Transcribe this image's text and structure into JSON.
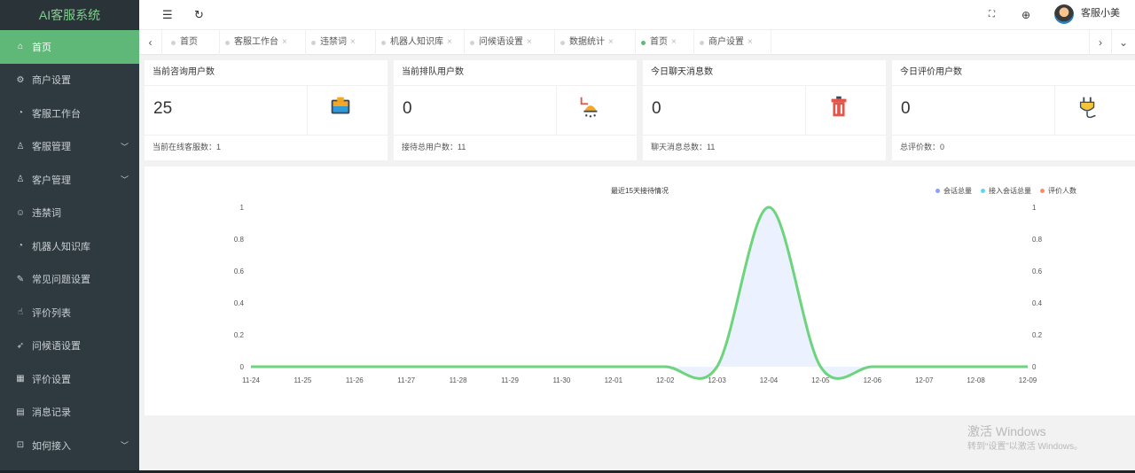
{
  "app": {
    "title": "AI客服系统"
  },
  "sidebar": {
    "items": [
      {
        "label": "首页",
        "icon": "home-icon",
        "glyph": "⌂",
        "active": true,
        "arrow": false
      },
      {
        "label": "商户设置",
        "icon": "gear-icon",
        "glyph": "⚙",
        "active": false,
        "arrow": false
      },
      {
        "label": "客服工作台",
        "icon": "headset-icon",
        "glyph": "◔",
        "active": false,
        "arrow": false
      },
      {
        "label": "客服管理",
        "icon": "user-icon",
        "glyph": "♙",
        "active": false,
        "arrow": true
      },
      {
        "label": "客户管理",
        "icon": "users-icon",
        "glyph": "♙",
        "active": false,
        "arrow": true
      },
      {
        "label": "违禁词",
        "icon": "smile-icon",
        "glyph": "☺",
        "active": false,
        "arrow": false
      },
      {
        "label": "机器人知识库",
        "icon": "robot-icon",
        "glyph": "◔",
        "active": false,
        "arrow": false
      },
      {
        "label": "常见问题设置",
        "icon": "edit-icon",
        "glyph": "✎",
        "active": false,
        "arrow": false
      },
      {
        "label": "评价列表",
        "icon": "thumb-icon",
        "glyph": "☝",
        "active": false,
        "arrow": false
      },
      {
        "label": "问候语设置",
        "icon": "send-icon",
        "glyph": "➶",
        "active": false,
        "arrow": false
      },
      {
        "label": "评价设置",
        "icon": "calendar-icon",
        "glyph": "▦",
        "active": false,
        "arrow": false
      },
      {
        "label": "消息记录",
        "icon": "message-icon",
        "glyph": "▤",
        "active": false,
        "arrow": false
      },
      {
        "label": "如何接入",
        "icon": "plug-icon",
        "glyph": "⊡",
        "active": false,
        "arrow": true
      }
    ],
    "arrow_glyph": "﹀"
  },
  "header": {
    "menu_glyph": "☰",
    "refresh_glyph": "↻",
    "fullscreen_glyph": "⛶",
    "language_glyph": "⊕",
    "username": "客服小美"
  },
  "tabs": {
    "prev_glyph": "‹",
    "next_glyph": "›",
    "more_glyph": "⌄",
    "close_glyph": "×",
    "items": [
      {
        "label": "首页",
        "closable": false,
        "active": false
      },
      {
        "label": "客服工作台",
        "closable": true,
        "active": false
      },
      {
        "label": "违禁词",
        "closable": true,
        "active": false
      },
      {
        "label": "机器人知识库",
        "closable": true,
        "active": false
      },
      {
        "label": "问候语设置",
        "closable": true,
        "active": false
      },
      {
        "label": "数据统计",
        "closable": true,
        "active": false
      },
      {
        "label": "首页",
        "closable": true,
        "active": true
      },
      {
        "label": "商户设置",
        "closable": true,
        "active": false
      }
    ]
  },
  "cards": [
    {
      "title": "当前咨询用户数",
      "value": "25",
      "footer": "当前在线客服数：1",
      "icon": "paint-bucket-icon"
    },
    {
      "title": "当前排队用户数",
      "value": "0",
      "footer": "接待总用户数：11",
      "icon": "shower-icon"
    },
    {
      "title": "今日聊天消息数",
      "value": "0",
      "footer": "聊天消息总数：11",
      "icon": "trash-icon"
    },
    {
      "title": "今日评价用户数",
      "value": "0",
      "footer": "总评价数：0",
      "icon": "plug-icon"
    }
  ],
  "chart_data": {
    "type": "line",
    "title": "最近15天接待情况",
    "categories": [
      "11-24",
      "11-25",
      "11-26",
      "11-27",
      "11-28",
      "11-29",
      "11-30",
      "12-01",
      "12-02",
      "12-03",
      "12-04",
      "12-05",
      "12-06",
      "12-07",
      "12-08",
      "12-09"
    ],
    "series": [
      {
        "name": "会话总量",
        "color": "#8c9eff",
        "values": [
          0,
          0,
          0,
          0,
          0,
          0,
          0,
          0,
          0,
          0,
          1,
          0,
          0,
          0,
          0,
          0
        ]
      },
      {
        "name": "接入会话总量",
        "color": "#62d4f0",
        "values": [
          0,
          0,
          0,
          0,
          0,
          0,
          0,
          0,
          0,
          0,
          1,
          0,
          0,
          0,
          0,
          0
        ]
      },
      {
        "name": "评价人数",
        "color": "#ff8a70",
        "values": [
          0,
          0,
          0,
          0,
          0,
          0,
          0,
          0,
          0,
          0,
          0,
          0,
          0,
          0,
          0,
          0
        ]
      }
    ],
    "yticks": [
      "0",
      "0.2",
      "0.4",
      "0.6",
      "0.8",
      "1"
    ],
    "ylim": [
      0,
      1
    ],
    "grid": false,
    "legend_position": "top-right",
    "line_color": "#6dd46f",
    "baseline_color_start": "#c8e6a0",
    "baseline_color_end": "#f48a7e"
  },
  "watermark": {
    "line1": "激活 Windows",
    "line2": "转到“设置”以激活 Windows。"
  }
}
